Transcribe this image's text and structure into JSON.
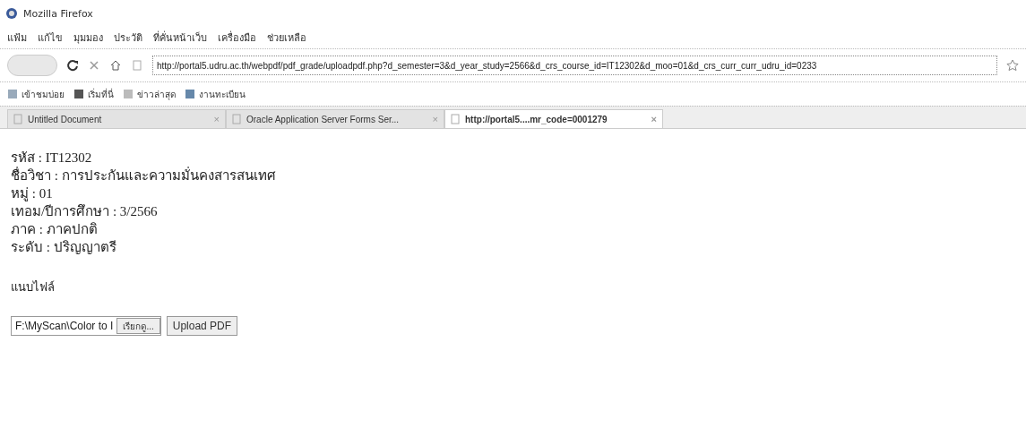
{
  "window": {
    "title": "Mozilla Firefox"
  },
  "menu": [
    "แฟ้ม",
    "แก้ไข",
    "มุมมอง",
    "ประวัติ",
    "ที่คั่นหน้าเว็บ",
    "เครื่องมือ",
    "ช่วยเหลือ"
  ],
  "address_bar": {
    "value": "http://portal5.udru.ac.th/webpdf/pdf_grade/uploadpdf.php?d_semester=3&d_year_study=2566&d_crs_course_id=IT12302&d_moo=01&d_crs_curr_curr_udru_id=0233"
  },
  "bookmarks": [
    "เข้าชมบ่อย",
    "เริ่มที่นี่",
    "ข่าวล่าสุด",
    "งานทะเบียน"
  ],
  "tabs": [
    {
      "label": "Untitled Document",
      "close": "×",
      "selected": false
    },
    {
      "label": "Oracle Application Server Forms Ser...",
      "close": "×",
      "selected": false
    },
    {
      "label": "http://portal5....mr_code=0001279",
      "close": "×",
      "selected": true
    }
  ],
  "details": [
    "รหัส : IT12302",
    "ชื่อวิชา : การประกันและความมั่นคงสารสนเทศ",
    "หมู่ : 01",
    "เทอม/ปีการศึกษา : 3/2566",
    "ภาค : ภาคปกติ",
    "ระดับ : ปริญญาตรี"
  ],
  "attach_label": "แนบไฟล์",
  "file_field": {
    "value": "F:\\MyScan\\Color to I",
    "browse": "เรียกดู..."
  },
  "upload_button": "Upload PDF"
}
